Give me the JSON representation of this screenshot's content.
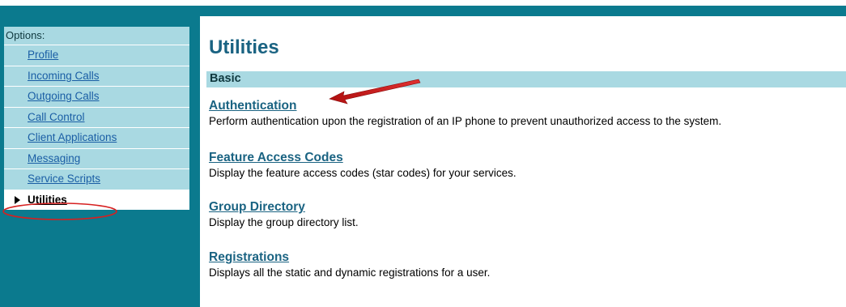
{
  "sidebar": {
    "title": "Options:",
    "items": [
      {
        "label": "Profile"
      },
      {
        "label": "Incoming Calls"
      },
      {
        "label": "Outgoing Calls"
      },
      {
        "label": "Call Control"
      },
      {
        "label": "Client Applications"
      },
      {
        "label": "Messaging"
      },
      {
        "label": "Service Scripts"
      },
      {
        "label": "Utilities"
      }
    ]
  },
  "main": {
    "title": "Utilities",
    "section": "Basic",
    "entries": [
      {
        "link": "Authentication",
        "desc": "Perform authentication upon the registration of an IP phone to prevent unauthorized access to the system."
      },
      {
        "link": "Feature Access Codes",
        "desc": "Display the feature access codes (star codes) for your services."
      },
      {
        "link": "Group Directory",
        "desc": "Display the group directory list."
      },
      {
        "link": "Registrations",
        "desc": "Displays all the static and dynamic registrations for a user."
      }
    ]
  },
  "colors": {
    "header_teal": "#0b7a8e",
    "nav_bg": "#a9d9e2",
    "link_blue": "#1a6382",
    "annotation_red": "#d62020"
  },
  "annotations": {
    "arrow_icon": "red-arrow-icon",
    "circle_icon": "red-circle-icon"
  }
}
